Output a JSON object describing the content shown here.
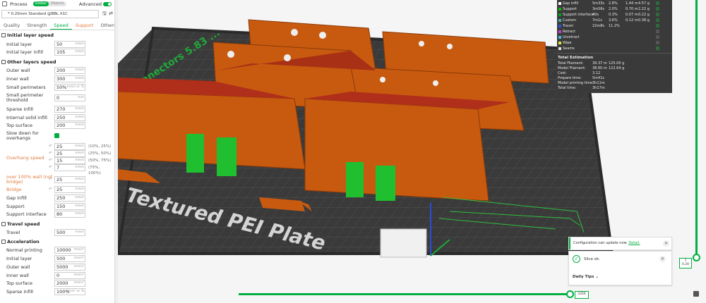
{
  "header": {
    "title": "Process",
    "mode_global": "Global",
    "mode_objects": "Objects",
    "advanced_label": "Advanced"
  },
  "preset": {
    "name": "* 0.20mm Standard @BBL X1C"
  },
  "tabs": [
    {
      "label": "Quality"
    },
    {
      "label": "Strength"
    },
    {
      "label": "Speed"
    },
    {
      "label": "Support"
    },
    {
      "label": "Others"
    }
  ],
  "sections": {
    "initial_layer_speed": "Initial layer speed",
    "other_layers_speed": "Other layers speed",
    "travel_speed": "Travel speed",
    "acceleration": "Acceleration"
  },
  "initial": [
    {
      "label": "Initial layer",
      "value": "50",
      "unit": "mm/s"
    },
    {
      "label": "Initial layer infill",
      "value": "105",
      "unit": "mm/s"
    }
  ],
  "other": [
    {
      "label": "Outer wall",
      "value": "200",
      "unit": "mm/s"
    },
    {
      "label": "Inner wall",
      "value": "300",
      "unit": "mm/s"
    },
    {
      "label": "Small perimeters",
      "value": "50%",
      "unit": "mm/s or %"
    },
    {
      "label1": "Small perimeter",
      "label2": "threshold",
      "value": "0",
      "unit": "mm"
    },
    {
      "label": "Sparse infill",
      "value": "270",
      "unit": "mm/s"
    },
    {
      "label": "Internal solid infill",
      "value": "250",
      "unit": "mm/s"
    },
    {
      "label": "Top surface",
      "value": "200",
      "unit": "mm/s"
    }
  ],
  "slowdown": {
    "label1": "Slow down for",
    "label2": "overhangs"
  },
  "overhang": {
    "label": "Overhang speed",
    "rows": [
      {
        "value": "25",
        "range": "(10%, 25%)"
      },
      {
        "value": "25",
        "range": "(25%, 50%)"
      },
      {
        "value": "15",
        "range": "(50%, 75%)"
      },
      {
        "value": "7",
        "range": "(75%, 100%)"
      }
    ],
    "unit": "mm/s"
  },
  "other2": [
    {
      "label1": "over 100% wall (not",
      "label2": "bridge)",
      "value": "25",
      "unit": "mm/s",
      "orange": true
    },
    {
      "label": "Bridge",
      "value": "25",
      "unit": "mm/s",
      "orange": true
    },
    {
      "label": "Gap infill",
      "value": "250",
      "unit": "mm/s"
    },
    {
      "label": "Support",
      "value": "150",
      "unit": "mm/s"
    },
    {
      "label": "Support interface",
      "value": "80",
      "unit": "mm/s"
    }
  ],
  "travel": [
    {
      "label": "Travel",
      "value": "500",
      "unit": "mm/s"
    }
  ],
  "accel": [
    {
      "label": "Normal printing",
      "value": "10000",
      "unit": "mm/s²"
    },
    {
      "label": "Initial layer",
      "value": "500",
      "unit": "mm/s²"
    },
    {
      "label": "Outer wall",
      "value": "5000",
      "unit": "mm/s²"
    },
    {
      "label": "Inner wall",
      "value": "0",
      "unit": "mm/s²"
    },
    {
      "label": "Top surface",
      "value": "2000",
      "unit": "mm/s²"
    },
    {
      "label": "Sparse infill",
      "value": "100%",
      "unit": "mm/s² or %"
    }
  ],
  "legend": {
    "rows": [
      {
        "name": "Gap infill",
        "color": "#ffffff",
        "c1": "5m33s",
        "c2": "2.8%",
        "c3": "1.44 m",
        "c4": "4.57 g"
      },
      {
        "name": "Support",
        "color": "#00c000",
        "c1": "3m56s",
        "c2": "2.0%",
        "c3": "0.70 m",
        "c4": "2.22 g"
      },
      {
        "name": "Support interface",
        "color": "#00a020",
        "c1": "40s",
        "c2": "0.3%",
        "c3": "0.07 m",
        "c4": "0.22 g"
      },
      {
        "name": "Custom",
        "color": "#4db0b0",
        "c1": "7m1s",
        "c2": "3.6%",
        "c3": "0.12 m",
        "c4": "0.38 g"
      },
      {
        "name": "Travel",
        "color": "#3050e0",
        "c1": "22m8s",
        "c2": "11.2%",
        "c3": "",
        "c4": ""
      },
      {
        "name": "Retract",
        "color": "#c040c0",
        "c1": "",
        "c2": "",
        "c3": "",
        "c4": ""
      },
      {
        "name": "Unretract",
        "color": "#40c0e0",
        "c1": "",
        "c2": "",
        "c3": "",
        "c4": ""
      },
      {
        "name": "Wipe",
        "color": "#e0e040",
        "c1": "",
        "c2": "",
        "c3": "",
        "c4": ""
      },
      {
        "name": "Seams",
        "color": "#e0e0e0",
        "c1": "",
        "c2": "",
        "c3": "",
        "c4": ""
      }
    ],
    "estimation_title": "Total Estimation",
    "estimation": [
      {
        "name": "Total Filament:",
        "a": "39.37 m",
        "b": "125.00 g"
      },
      {
        "name": "Model Filament:",
        "a": "38.60 m",
        "b": "122.64 g"
      },
      {
        "name": "Cost:",
        "a": "3.12",
        "b": ""
      },
      {
        "name": "Prepare time:",
        "a": "5m41s",
        "b": ""
      },
      {
        "name": "Model printing time:",
        "a": "3h11m",
        "b": ""
      },
      {
        "name": "Total time:",
        "a": "3h17m",
        "b": ""
      }
    ]
  },
  "plate": {
    "label": "Textured PEI Plate",
    "model_text": "Connectors 5.83 ..."
  },
  "layer_slider": {
    "top": "1",
    "value": "0.20"
  },
  "move_slider": {
    "value": "3356"
  },
  "notifications": {
    "config_text": "Configuration can update now.",
    "config_link": "Detail.",
    "slice_text": "Slice ok.",
    "tips_title": "Daily Tips"
  }
}
